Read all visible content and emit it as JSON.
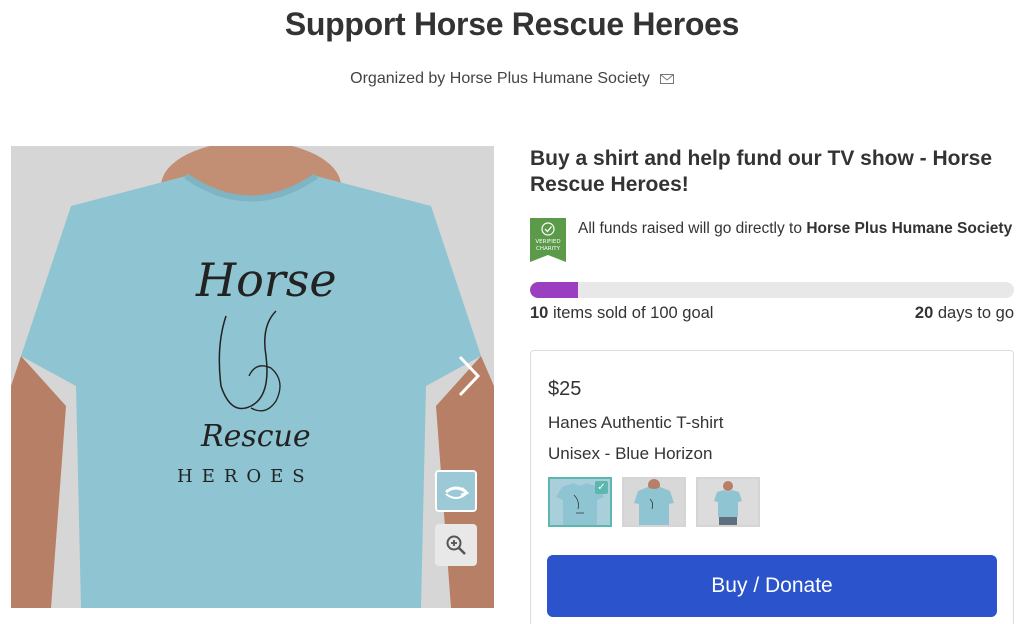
{
  "page": {
    "title": "Support Horse Rescue Heroes",
    "organized_by_prefix": "Organized by",
    "organizer_name": "Horse Plus Humane Society"
  },
  "campaign": {
    "headline": "Buy a shirt and help fund our TV show - Horse Rescue Heroes!",
    "charity_note_prefix": "All funds raised will go directly to",
    "charity_name": "Horse Plus Humane Society",
    "badge_line1": "VERIFIED",
    "badge_line2": "CHARITY",
    "items_sold": "10",
    "items_sold_suffix": "items sold of 100 goal",
    "progress_fraction": 0.1,
    "days_left": "20",
    "days_left_suffix": "days to go"
  },
  "product": {
    "price": "$25",
    "name": "Hanes Authentic T-shirt",
    "variant": "Unisex - Blue Horizon",
    "buy_label": "Buy / Donate"
  },
  "shirt_print": {
    "word1": "Horse",
    "word2": "Rescue",
    "word3": "HEROES"
  },
  "icons": {
    "mail": "envelope-icon",
    "next": "chevron-right-icon",
    "rotate": "rotate-icon",
    "zoom": "zoom-in-icon",
    "verified": "verified-charity-badge",
    "check": "check-icon"
  },
  "colors": {
    "accent_purple": "#9a3fbf",
    "button_blue": "#2b53cc",
    "shirt_blue": "#8fc4d2",
    "verified_green": "#5a9a48",
    "selected_teal": "#5bb7b0"
  }
}
